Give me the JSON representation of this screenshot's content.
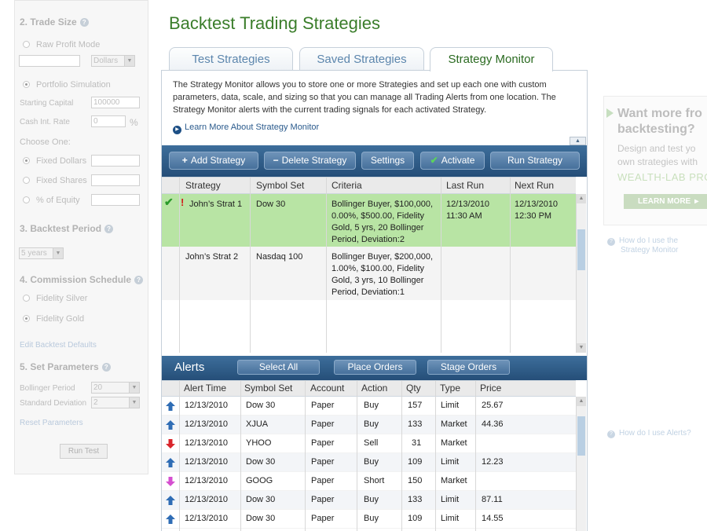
{
  "left_panel": {
    "trade_size": {
      "heading": "2. Trade Size",
      "raw_profit_label": "Raw Profit Mode",
      "currency_value": "Dollars",
      "portfolio_label": "Portfolio Simulation",
      "starting_capital_label": "Starting Capital",
      "starting_capital_value": "100000",
      "cash_int_label": "Cash Int. Rate",
      "cash_int_value": "0",
      "percent_sign": "%",
      "choose_one_label": "Choose One:",
      "fixed_dollars_label": "Fixed Dollars",
      "fixed_shares_label": "Fixed Shares",
      "pct_equity_label": "% of Equity"
    },
    "backtest_period": {
      "heading": "3. Backtest Period",
      "value": "5 years"
    },
    "commission": {
      "heading": "4. Commission Schedule",
      "silver_label": "Fidelity Silver",
      "gold_label": "Fidelity Gold",
      "edit_defaults_link": "Edit Backtest Defaults"
    },
    "parameters": {
      "heading": "5. Set Parameters",
      "bollinger_label": "Bollinger Period",
      "bollinger_value": "20",
      "std_dev_label": "Standard Deviation",
      "std_dev_value": "2",
      "reset_link": "Reset Parameters"
    },
    "run_test_label": "Run Test"
  },
  "page": {
    "title": "Backtest Trading Strategies"
  },
  "tabs": [
    {
      "label": "Test Strategies",
      "active": false
    },
    {
      "label": "Saved Strategies",
      "active": false
    },
    {
      "label": "Strategy Monitor",
      "active": true
    }
  ],
  "intro": {
    "text": "The Strategy Monitor allows you to store one or more Strategies and set up each one with custom parameters, data, scale, and sizing so that you can manage all Trading Alerts from one location. The Strategy Monitor alerts with the current trading signals for each activated Strategy.",
    "learn_more": "Learn More About Strategy Monitor"
  },
  "strategy_toolbar": {
    "add": "Add Strategy",
    "add_prefix": "+",
    "delete": "Delete Strategy",
    "delete_prefix": "−",
    "settings": "Settings",
    "activate": "Activate",
    "run": "Run Strategy"
  },
  "strategy_table": {
    "columns": [
      "Strategy",
      "Symbol Set",
      "Criteria",
      "Last Run",
      "Next Run"
    ],
    "rows": [
      {
        "active": true,
        "warning": true,
        "name": "John’s Strat 1",
        "symbol_set": "Dow 30",
        "criteria": "Bollinger Buyer, $100,000, 0.00%, $500.00, Fidelity Gold, 5 yrs, 20 Bollinger Period, Deviation:2",
        "last_run_date": "12/13/2010",
        "last_run_time": "11:30 AM",
        "next_run_date": "12/13/2010",
        "next_run_time": "12:30 PM"
      },
      {
        "active": false,
        "warning": false,
        "name": "John’s Strat 2",
        "symbol_set": "Nasdaq 100",
        "criteria": "Bollinger Buyer, $200,000, 1.00%, $100.00, Fidelity Gold, 3 yrs, 10 Bollinger Period, Deviation:1",
        "last_run_date": "",
        "last_run_time": "",
        "next_run_date": "",
        "next_run_time": ""
      }
    ]
  },
  "alerts_toolbar": {
    "title": "Alerts",
    "select_all": "Select All",
    "place_orders": "Place Orders",
    "stage_orders": "Stage Orders"
  },
  "alerts_table": {
    "columns": [
      "Alert Time",
      "Symbol Set",
      "Account",
      "Action",
      "Qty",
      "Type",
      "Price"
    ],
    "rows": [
      {
        "direction": "up",
        "time": "12/13/2010",
        "symbol": "Dow 30",
        "account": "Paper",
        "action": "Buy",
        "qty": "157",
        "type": "Limit",
        "price": "25.67"
      },
      {
        "direction": "up",
        "time": "12/13/2010",
        "symbol": "XJUA",
        "account": "Paper",
        "action": "Buy",
        "qty": "133",
        "type": "Market",
        "price": "44.36"
      },
      {
        "direction": "down",
        "time": "12/13/2010",
        "symbol": "YHOO",
        "account": "Paper",
        "action": "Sell",
        "qty": "31",
        "type": "Market",
        "price": ""
      },
      {
        "direction": "up",
        "time": "12/13/2010",
        "symbol": "Dow 30",
        "account": "Paper",
        "action": "Buy",
        "qty": "109",
        "type": "Limit",
        "price": "12.23"
      },
      {
        "direction": "short",
        "time": "12/13/2010",
        "symbol": "GOOG",
        "account": "Paper",
        "action": "Short",
        "qty": "150",
        "type": "Market",
        "price": ""
      },
      {
        "direction": "up",
        "time": "12/13/2010",
        "symbol": "Dow 30",
        "account": "Paper",
        "action": "Buy",
        "qty": "133",
        "type": "Limit",
        "price": "87.11"
      },
      {
        "direction": "up",
        "time": "12/13/2010",
        "symbol": "Dow 30",
        "account": "Paper",
        "action": "Buy",
        "qty": "109",
        "type": "Limit",
        "price": "14.55"
      }
    ]
  },
  "promo": {
    "title_line1": "Want more fro",
    "title_line2": "backtesting?",
    "body_line1": "Design and test yo",
    "body_line2": "own strategies with",
    "brand": "WEALTH-LAB PRO",
    "button": "LEARN MORE"
  },
  "side_help": {
    "monitor_line1": "How do I use the",
    "monitor_line2": "Strategy Monitor",
    "alerts": "How do I use Alerts?"
  },
  "colors": {
    "title_green": "#3a7d2a",
    "toolbar_blue": "#2f5d8a",
    "active_row_green": "#b8e4a4",
    "arrow_up_blue": "#2f6db5",
    "arrow_down_red": "#d9262c",
    "arrow_short_pink": "#d54fd0"
  }
}
